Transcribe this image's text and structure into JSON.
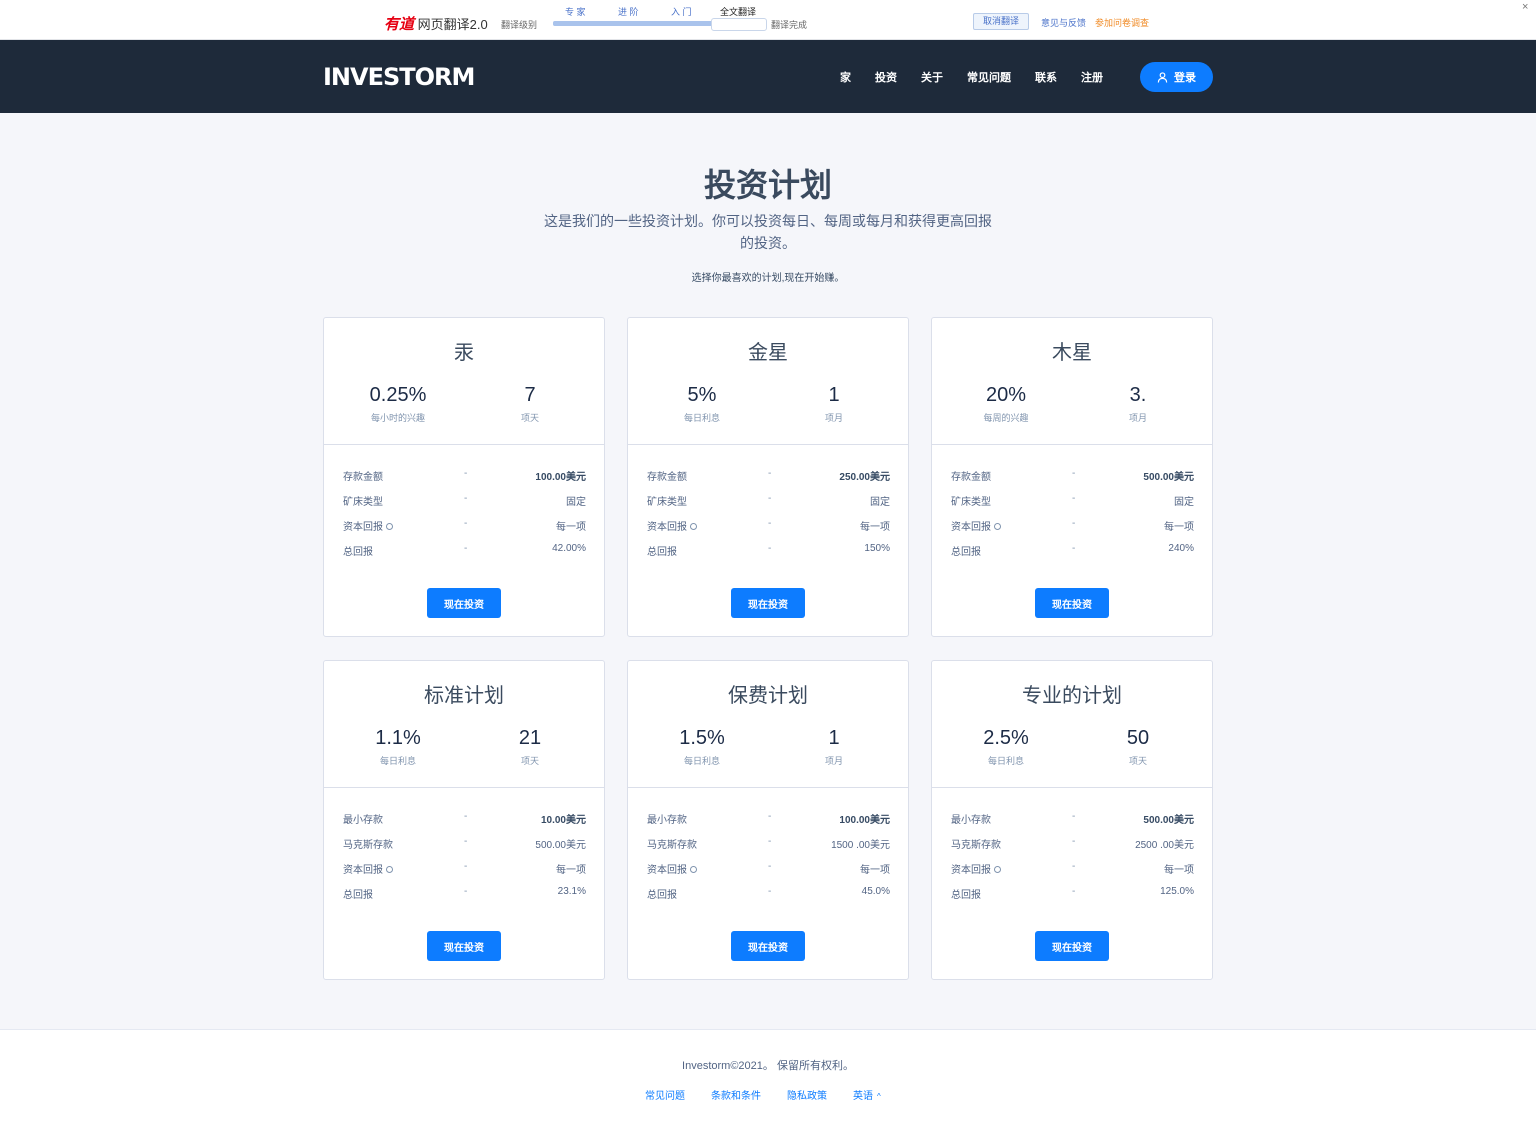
{
  "translate_bar": {
    "brand": "有道",
    "product": "网页翻译2.0",
    "level_label": "翻译级别",
    "levels": [
      "专 家",
      "进 阶",
      "入 门",
      "全文翻译"
    ],
    "done": "翻译完成",
    "cancel": "取消翻译",
    "feedback": "意见与反馈",
    "survey": "参加问卷调查",
    "close": "×"
  },
  "header": {
    "logo": "INVESTORM",
    "nav": [
      "家",
      "投资",
      "关于",
      "常见问题",
      "联系",
      "注册"
    ],
    "login": "登录"
  },
  "hero": {
    "title": "投资计划",
    "subtitle": "这是我们的一些投资计划。你可以投资每日、每周或每月和获得更高回报的投资。",
    "note": "选择你最喜欢的计划,现在开始赚。"
  },
  "plans": [
    {
      "name": "汞",
      "rate": "0.25%",
      "rate_label": "每小时的兴趣",
      "term": "7",
      "term_label": "项天",
      "rows": [
        {
          "k": "存款金额",
          "v": "100.00美元"
        },
        {
          "k": "矿床类型",
          "v": "固定"
        },
        {
          "k": "资本回报",
          "v": "每一项"
        },
        {
          "k": "总回报",
          "v": "42.00%"
        }
      ],
      "button": "现在投资"
    },
    {
      "name": "金星",
      "rate": "5%",
      "rate_label": "每日利息",
      "term": "1",
      "term_label": "项月",
      "rows": [
        {
          "k": "存款金额",
          "v": "250.00美元"
        },
        {
          "k": "矿床类型",
          "v": "固定"
        },
        {
          "k": "资本回报",
          "v": "每一项"
        },
        {
          "k": "总回报",
          "v": "150%"
        }
      ],
      "button": "现在投资"
    },
    {
      "name": "木星",
      "rate": "20%",
      "rate_label": "每周的兴趣",
      "term": "3.",
      "term_label": "项月",
      "rows": [
        {
          "k": "存款金额",
          "v": "500.00美元"
        },
        {
          "k": "矿床类型",
          "v": "固定"
        },
        {
          "k": "资本回报",
          "v": "每一项"
        },
        {
          "k": "总回报",
          "v": "240%"
        }
      ],
      "button": "现在投资"
    },
    {
      "name": "标准计划",
      "rate": "1.1%",
      "rate_label": "每日利息",
      "term": "21",
      "term_label": "项天",
      "rows": [
        {
          "k": "最小存款",
          "v": "10.00美元"
        },
        {
          "k": "马克斯存款",
          "v": "500.00美元"
        },
        {
          "k": "资本回报",
          "v": "每一项"
        },
        {
          "k": "总回报",
          "v": "23.1%"
        }
      ],
      "button": "现在投资"
    },
    {
      "name": "保费计划",
      "rate": "1.5%",
      "rate_label": "每日利息",
      "term": "1",
      "term_label": "项月",
      "rows": [
        {
          "k": "最小存款",
          "v": "100.00美元"
        },
        {
          "k": "马克斯存款",
          "v": "1500 .00美元"
        },
        {
          "k": "资本回报",
          "v": "每一项"
        },
        {
          "k": "总回报",
          "v": "45.0%"
        }
      ],
      "button": "现在投资"
    },
    {
      "name": "专业的计划",
      "rate": "2.5%",
      "rate_label": "每日利息",
      "term": "50",
      "term_label": "项天",
      "rows": [
        {
          "k": "最小存款",
          "v": "500.00美元"
        },
        {
          "k": "马克斯存款",
          "v": "2500 .00美元"
        },
        {
          "k": "资本回报",
          "v": "每一项"
        },
        {
          "k": "总回报",
          "v": "125.0%"
        }
      ],
      "button": "现在投资"
    }
  ],
  "footer": {
    "copyright": "Investorm©2021。 保留所有权利。",
    "links": [
      "常见问题",
      "条款和条件",
      "隐私政策",
      "英语"
    ]
  },
  "colors": {
    "header_bg": "#1e2a3a",
    "accent": "#0d7cff",
    "page_bg": "#f5f6fa"
  }
}
